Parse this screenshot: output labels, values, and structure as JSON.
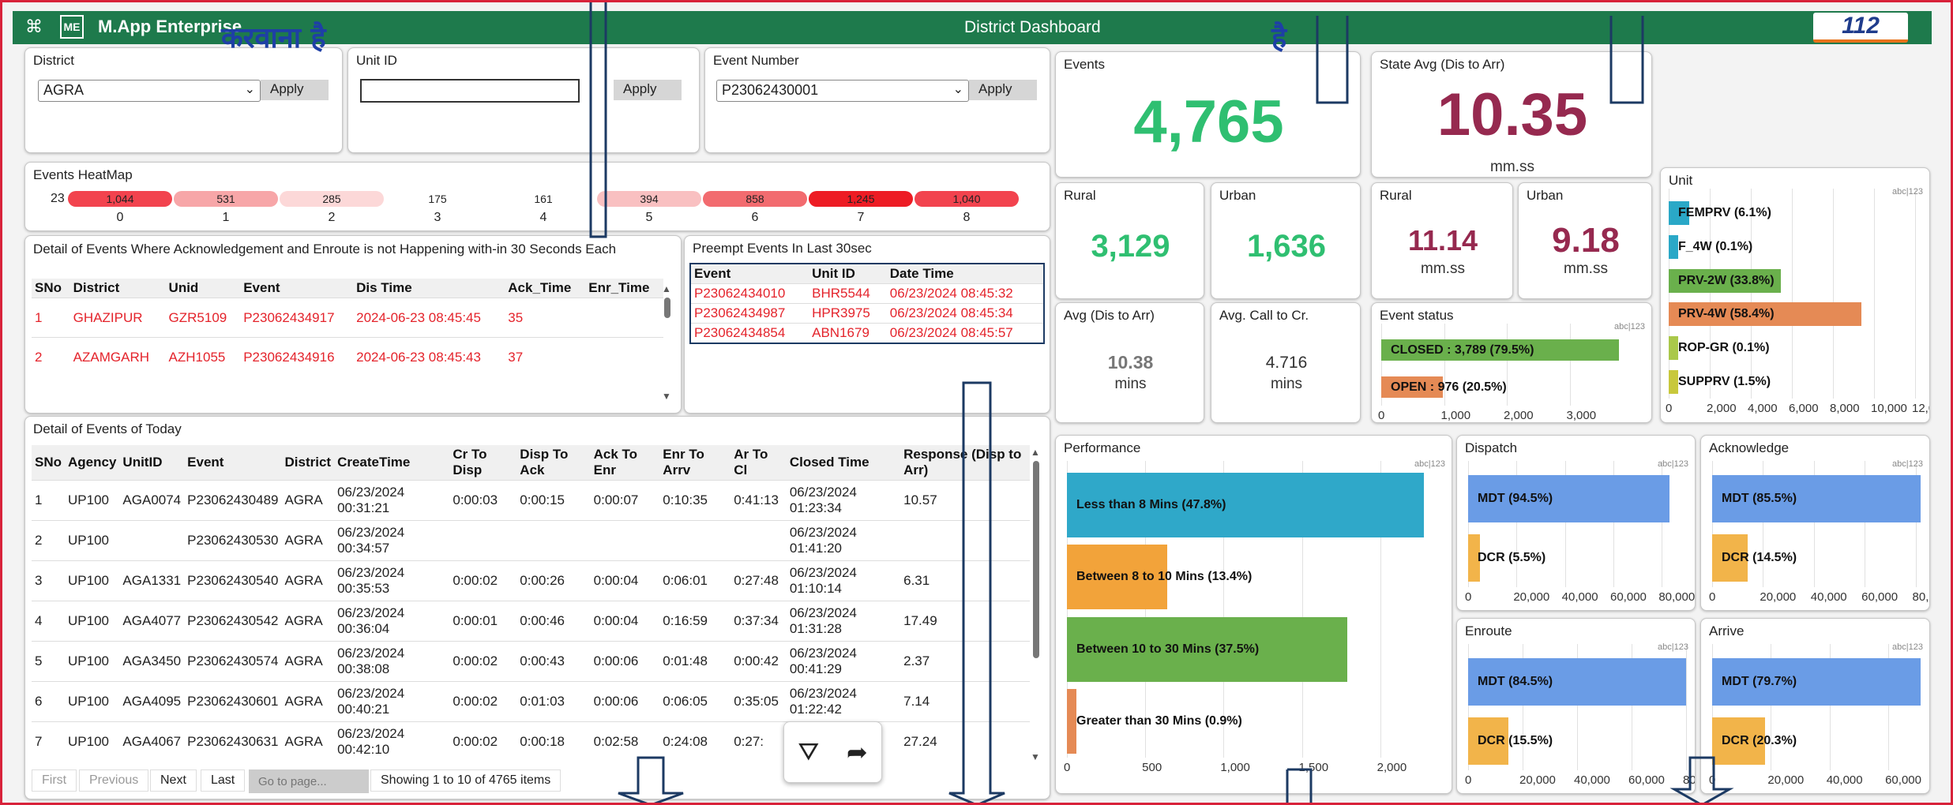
{
  "header": {
    "app_name": "M.App Enterprise",
    "me_label": "ME",
    "title": "District Dashboard",
    "logo_text": "112"
  },
  "overlay": {
    "line1": "करवाना है",
    "line2": "है"
  },
  "filters": {
    "district": {
      "label": "District",
      "value": "AGRA",
      "apply": "Apply"
    },
    "unit": {
      "label": "Unit ID",
      "value": "",
      "apply": "Apply"
    },
    "event": {
      "label": "Event Number",
      "value": "P23062430001",
      "apply": "Apply"
    }
  },
  "heatmap": {
    "title": "Events HeatMap",
    "first_value": "23",
    "cells": [
      {
        "value": "1,044",
        "label": "0",
        "color": "#f2434e"
      },
      {
        "value": "531",
        "label": "1",
        "color": "#f7a6a8"
      },
      {
        "value": "285",
        "label": "2",
        "color": "#fcd8d8"
      },
      {
        "value": "175",
        "label": "3",
        "color": "#ffffff"
      },
      {
        "value": "161",
        "label": "4",
        "color": "#ffffff"
      },
      {
        "value": "394",
        "label": "5",
        "color": "#f9c0c1"
      },
      {
        "value": "858",
        "label": "6",
        "color": "#f26b6f"
      },
      {
        "value": "1,245",
        "label": "7",
        "color": "#ed1c24"
      },
      {
        "value": "1,040",
        "label": "8",
        "color": "#f2434e"
      }
    ]
  },
  "delay_table": {
    "title": "Detail of Events Where Acknowledgement and Enroute is not Happening with-in 30 Seconds Each",
    "headers": [
      "SNo",
      "District",
      "Unid",
      "Event",
      "Dis Time",
      "Ack_Time",
      "Enr_Time"
    ],
    "rows": [
      [
        "1",
        "GHAZIPUR",
        "GZR5109",
        "P23062434917",
        "2024-06-23 08:45:45",
        "35",
        ""
      ],
      [
        "2",
        "AZAMGARH",
        "AZH1055",
        "P23062434916",
        "2024-06-23 08:45:43",
        "37",
        ""
      ]
    ]
  },
  "preempt": {
    "title": "Preempt Events In Last 30sec",
    "headers": [
      "Event",
      "Unit ID",
      "Date Time"
    ],
    "rows": [
      [
        "P23062434010",
        "BHR5544",
        "06/23/2024 08:45:32"
      ],
      [
        "P23062434987",
        "HPR3975",
        "06/23/2024 08:45:34"
      ],
      [
        "P23062434854",
        "ABN1679",
        "06/23/2024 08:45:57"
      ]
    ]
  },
  "today": {
    "title": "Detail of Events of Today",
    "headers": [
      "SNo",
      "Agency",
      "UnitID",
      "Event",
      "District",
      "CreateTime",
      "Cr To Disp",
      "Disp To Ack",
      "Ack To Enr",
      "Enr To Arrv",
      "Ar To Cl",
      "Closed Time",
      "Response (Disp to Arr)"
    ],
    "rows": [
      [
        "1",
        "UP100",
        "AGA0074",
        "P23062430489",
        "AGRA",
        "06/23/2024 00:31:21",
        "0:00:03",
        "0:00:15",
        "0:00:07",
        "0:10:35",
        "0:41:13",
        "06/23/2024 01:23:34",
        "10.57"
      ],
      [
        "2",
        "UP100",
        "",
        "P23062430530",
        "AGRA",
        "06/23/2024 00:34:57",
        "",
        "",
        "",
        "",
        "",
        "06/23/2024 01:41:20",
        ""
      ],
      [
        "3",
        "UP100",
        "AGA1331",
        "P23062430540",
        "AGRA",
        "06/23/2024 00:35:53",
        "0:00:02",
        "0:00:26",
        "0:00:04",
        "0:06:01",
        "0:27:48",
        "06/23/2024 01:10:14",
        "6.31"
      ],
      [
        "4",
        "UP100",
        "AGA4077",
        "P23062430542",
        "AGRA",
        "06/23/2024 00:36:04",
        "0:00:01",
        "0:00:46",
        "0:00:04",
        "0:16:59",
        "0:37:34",
        "06/23/2024 01:31:28",
        "17.49"
      ],
      [
        "5",
        "UP100",
        "AGA3450",
        "P23062430574",
        "AGRA",
        "06/23/2024 00:38:08",
        "0:00:02",
        "0:00:43",
        "0:00:06",
        "0:01:48",
        "0:00:42",
        "06/23/2024 00:41:29",
        "2.37"
      ],
      [
        "6",
        "UP100",
        "AGA4095",
        "P23062430601",
        "AGRA",
        "06/23/2024 00:40:21",
        "0:00:02",
        "0:01:03",
        "0:00:06",
        "0:06:05",
        "0:35:05",
        "06/23/2024 01:22:42",
        "7.14"
      ],
      [
        "7",
        "UP100",
        "AGA4067",
        "P23062430631",
        "AGRA",
        "06/23/2024 00:42:10",
        "0:00:02",
        "0:00:18",
        "0:02:58",
        "0:24:08",
        "0:27:",
        "",
        "27.24"
      ]
    ],
    "pager": {
      "first": "First",
      "previous": "Previous",
      "next": "Next",
      "last": "Last",
      "goto_placeholder": "Go to page...",
      "summary": "Showing 1 to 10 of 4765 items"
    }
  },
  "kpi": {
    "events": {
      "label": "Events",
      "value": "4,765"
    },
    "state_avg": {
      "label": "State Avg (Dis to Arr)",
      "value": "10.35",
      "unit": "mm.ss"
    },
    "rural_events": {
      "label": "Rural",
      "value": "3,129"
    },
    "urban_events": {
      "label": "Urban",
      "value": "1,636"
    },
    "rural_time": {
      "label": "Rural",
      "value": "11.14",
      "unit": "mm.ss"
    },
    "urban_time": {
      "label": "Urban",
      "value": "9.18",
      "unit": "mm.ss"
    },
    "avg_dis_arr": {
      "label": "Avg (Dis to Arr)",
      "value": "10.38",
      "unit": "mins"
    },
    "avg_call_cr": {
      "label": "Avg. Call to Cr.",
      "value": "4.716",
      "unit": "mins"
    },
    "colors": {
      "events": "#2fbf71",
      "state": "#96294f"
    }
  },
  "chart_data": [
    {
      "id": "event_status",
      "type": "bar",
      "title": "Event status",
      "categories": [
        "CLOSED : 3,789 (79.5%)",
        "OPEN : 976 (20.5%)"
      ],
      "values": [
        3789,
        976
      ],
      "colors": [
        "#6ab04c",
        "#e58a55"
      ],
      "xlim": [
        0,
        4000
      ],
      "ticks": [
        "0",
        "1,000",
        "2,000",
        "3,000"
      ]
    },
    {
      "id": "unit",
      "type": "bar",
      "title": "Unit",
      "categories": [
        "FEMPRV (6.1%)",
        "F_4W (0.1%)",
        "PRV-2W (33.8%)",
        "PRV-4W (58.4%)",
        "ROP-GR (0.1%)",
        "SUPPRV (1.5%)"
      ],
      "values": [
        1000,
        10,
        5450,
        9400,
        15,
        250
      ],
      "colors": [
        "#2aa8c7",
        "#2aa8c7",
        "#6ab04c",
        "#e58a55",
        "#aac84a",
        "#c8c83c"
      ],
      "xlim": [
        0,
        12000
      ],
      "ticks": [
        "0",
        "2,000",
        "4,000",
        "6,000",
        "8,000",
        "10,000",
        "12,000"
      ]
    },
    {
      "id": "performance",
      "type": "bar",
      "title": "Performance",
      "categories": [
        "Less than 8 Mins (47.8%)",
        "Between 8 to 10 Mins (13.4%)",
        "Between 10 to 30 Mins (37.5%)",
        "Greater than 30 Mins (0.9%)"
      ],
      "values": [
        2280,
        640,
        1790,
        43
      ],
      "colors": [
        "#2fa8c9",
        "#f2a33a",
        "#6ab04c",
        "#e58a55"
      ],
      "xlim": [
        0,
        2400
      ],
      "ticks": [
        "0",
        "500",
        "1,000",
        "1,500",
        "2,000"
      ]
    },
    {
      "id": "dispatch",
      "type": "bar",
      "title": "Dispatch",
      "categories": [
        "MDT (94.5%)",
        "DCR (5.5%)"
      ],
      "values": [
        83000,
        4800
      ],
      "colors": [
        "#6a9ce6",
        "#f2b44a"
      ],
      "xlim": [
        0,
        90000
      ],
      "ticks": [
        "0",
        "20,000",
        "40,000",
        "60,000",
        "80,000"
      ]
    },
    {
      "id": "acknowledge",
      "type": "bar",
      "title": "Acknowledge",
      "categories": [
        "MDT (85.5%)",
        "DCR (14.5%)"
      ],
      "values": [
        82000,
        14000
      ],
      "colors": [
        "#6a9ce6",
        "#f2b44a"
      ],
      "xlim": [
        0,
        82000
      ],
      "ticks": [
        "0",
        "20,000",
        "40,000",
        "60,000",
        "80,000"
      ]
    },
    {
      "id": "enroute",
      "type": "bar",
      "title": "Enroute",
      "categories": [
        "MDT (84.5%)",
        "DCR (15.5%)"
      ],
      "values": [
        80000,
        14700
      ],
      "colors": [
        "#6a9ce6",
        "#f2b44a"
      ],
      "xlim": [
        0,
        80000
      ],
      "ticks": [
        "0",
        "20,000",
        "40,000",
        "60,000",
        "80,000"
      ]
    },
    {
      "id": "arrive",
      "type": "bar",
      "title": "Arrive",
      "categories": [
        "MDT (79.7%)",
        "DCR (20.3%)"
      ],
      "values": [
        71000,
        18000
      ],
      "colors": [
        "#6a9ce6",
        "#f2b44a"
      ],
      "xlim": [
        0,
        71000
      ],
      "ticks": [
        "0",
        "20,000",
        "40,000",
        "60,000"
      ]
    }
  ],
  "watermark": "abc|123"
}
